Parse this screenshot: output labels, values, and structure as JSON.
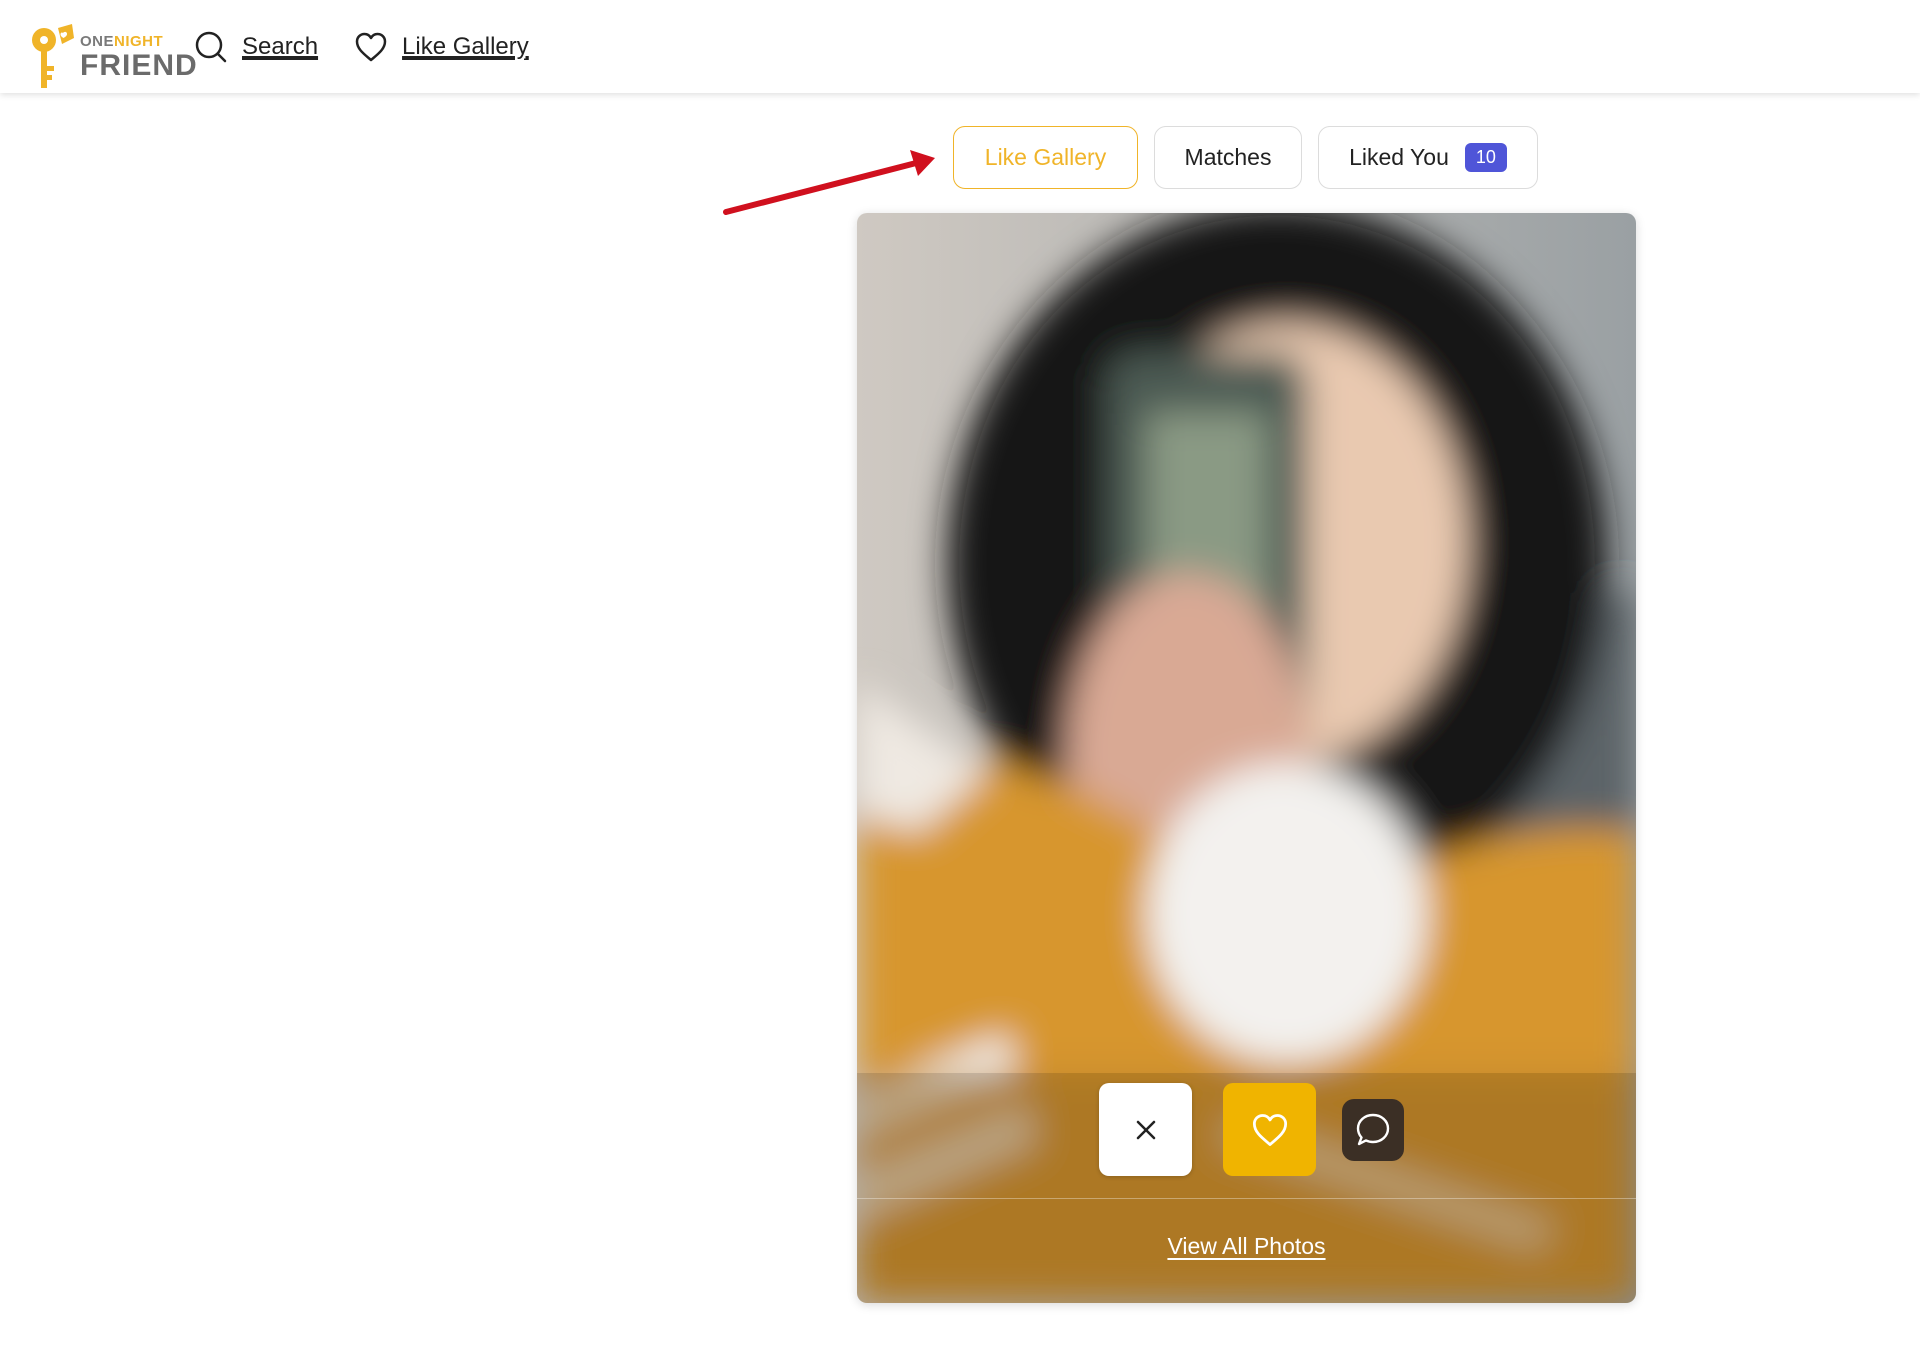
{
  "brand": {
    "logo_top_one": "ONE",
    "logo_top_night": "NIGHT",
    "logo_bottom": "FRIEND",
    "accent_color": "#f0b429"
  },
  "nav": {
    "search_label": "Search",
    "like_gallery_label": "Like Gallery",
    "search_icon": "search-icon",
    "heart_icon": "heart-icon"
  },
  "tabs": [
    {
      "label": "Like Gallery",
      "active": true
    },
    {
      "label": "Matches",
      "active": false
    },
    {
      "label": "Liked You",
      "active": false,
      "badge": "10"
    }
  ],
  "colors": {
    "badge": "#4f55d8",
    "like_button": "#f0b400",
    "chat_button": "#3b2f25",
    "annotation_arrow": "#d0101e"
  },
  "card": {
    "actions": {
      "close_icon": "close-icon",
      "like_icon": "heart-icon",
      "chat_icon": "chat-bubble-icon"
    },
    "view_all_label": "View All Photos"
  }
}
